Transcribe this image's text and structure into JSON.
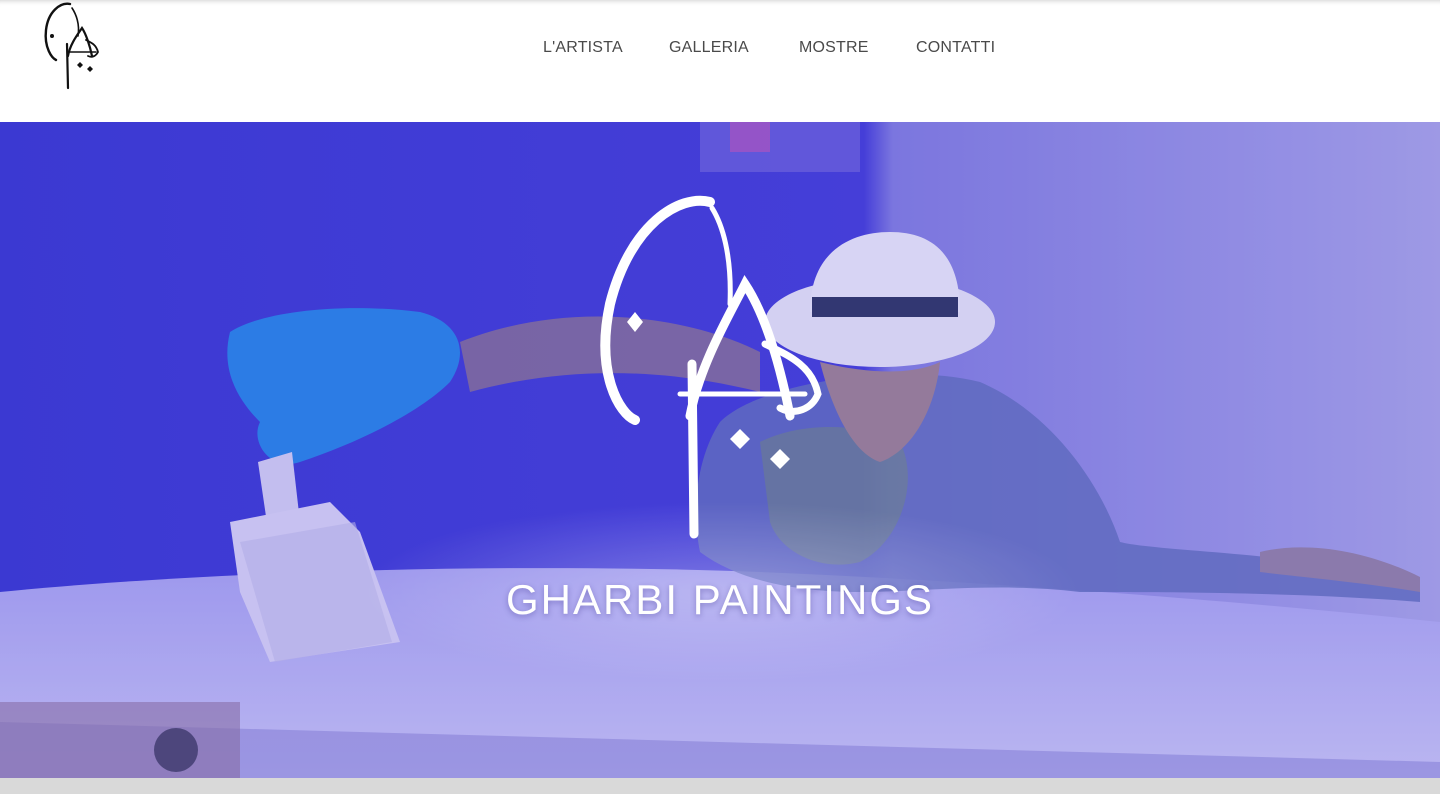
{
  "header": {
    "logo_alt": "CA",
    "nav": [
      {
        "label": "L'ARTISTA"
      },
      {
        "label": "GALLERIA"
      },
      {
        "label": "MOSTRE"
      },
      {
        "label": "CONTATTI"
      }
    ]
  },
  "hero": {
    "title": "GHARBI PAINTINGS",
    "background_description_icon": "artist-painting-photo",
    "logo_icon": "calligraphy-logo-icon"
  },
  "colors": {
    "nav_text": "#4a4a4a",
    "hero_blue": "#2f2fd6",
    "hero_text": "#ffffff",
    "footer_gray": "#d9d9d9"
  }
}
